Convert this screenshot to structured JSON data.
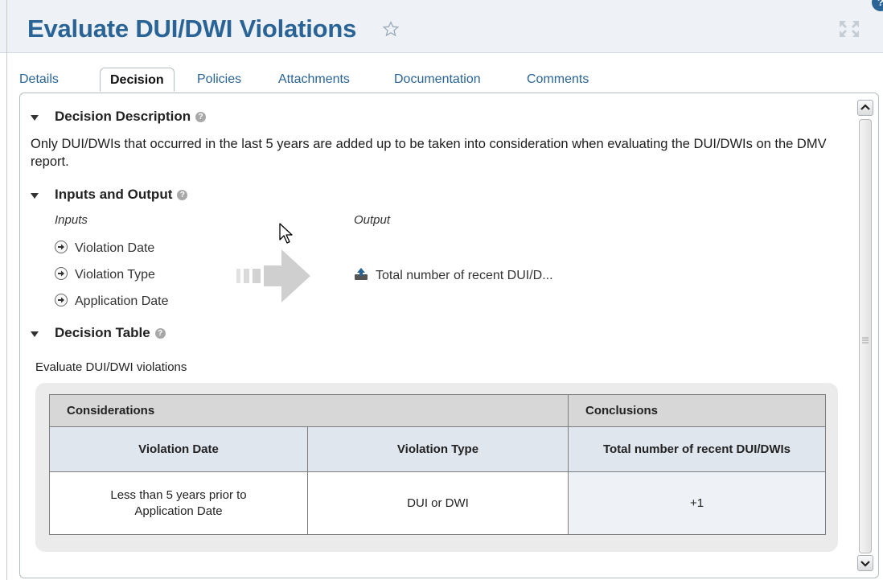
{
  "header": {
    "title": "Evaluate DUI/DWI Violations",
    "help_badge": "?"
  },
  "tabs": [
    {
      "label": "Details",
      "active": false
    },
    {
      "label": "Decision",
      "active": true
    },
    {
      "label": "Policies",
      "active": false
    },
    {
      "label": "Attachments",
      "active": false
    },
    {
      "label": "Documentation",
      "active": false
    },
    {
      "label": "Comments",
      "active": false
    }
  ],
  "decision_description": {
    "heading": "Decision Description",
    "text": "Only DUI/DWIs that occurred in the last 5 years are added up to be taken into consideration when evaluating the DUI/DWIs on the DMV report."
  },
  "inputs_output": {
    "heading": "Inputs and Output",
    "inputs_label": "Inputs",
    "output_label": "Output",
    "inputs": [
      "Violation Date",
      "Violation Type",
      "Application Date"
    ],
    "output": "Total number of recent DUI/D..."
  },
  "decision_table": {
    "heading": "Decision Table",
    "caption": "Evaluate DUI/DWI violations",
    "considerations_header": "Considerations",
    "conclusions_header": "Conclusions",
    "columns": [
      "Violation Date",
      "Violation Type",
      "Total number of recent DUI/DWIs"
    ],
    "rows": [
      [
        "Less than 5 years prior to Application Date",
        "DUI or DWI",
        "+1"
      ]
    ]
  },
  "icons": {
    "favorite": "star-outline-icon",
    "expand": "expand-icon",
    "help": "question-circle-icon",
    "input": "arrow-circle-right-icon",
    "output": "upload-icon"
  },
  "colors": {
    "title": "#2a6496",
    "header_bg": "#eef2f6",
    "tab_link": "#2a6496",
    "table_header": "#d7d7d7",
    "table_subheader": "#dfe6ee"
  }
}
